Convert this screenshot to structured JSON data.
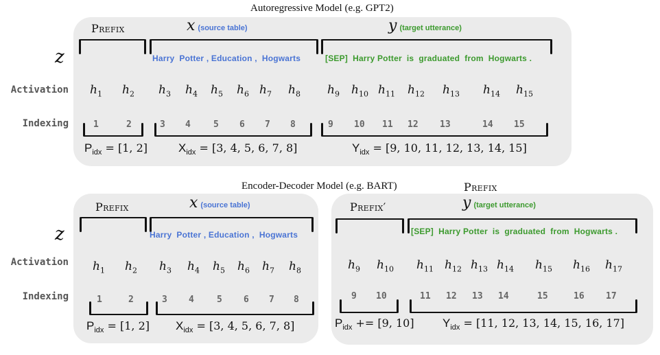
{
  "autoregressive": {
    "title": "Autoregressive Model  (e.g. GPT2)",
    "labels": {
      "prefix": "Prefix",
      "x": "x",
      "x_note": "(source table)",
      "y": "y",
      "y_note": "(target utterance)"
    },
    "source_tokens": "Harry  Potter , Education ,  Hogwarts",
    "target_tokens": "[SEP]  Harry Potter  is  graduated  from  Hogwarts .",
    "activations": [
      "1",
      "2",
      "3",
      "4",
      "5",
      "6",
      "7",
      "8",
      "9",
      "10",
      "11",
      "12",
      "13",
      "14",
      "15"
    ],
    "indices": [
      "1",
      "2",
      "3",
      "4",
      "5",
      "6",
      "7",
      "8",
      "9",
      "10",
      "11",
      "12",
      "13",
      "14",
      "15"
    ],
    "formulas": {
      "p_sym": "P",
      "p_sub": "idx",
      "p_rest": " = [1, 2]",
      "x_sym": "X",
      "x_sub": "idx",
      "x_rest": " = [3, 4, 5, 6, 7, 8]",
      "y_sym": "Y",
      "y_sub": "idx",
      "y_rest": " = [9, 10, 11, 12, 13, 14, 15]"
    }
  },
  "encoder_decoder": {
    "title": "Encoder-Decoder Model  (e.g. BART)",
    "extra_label": "Prefix",
    "encoder": {
      "labels": {
        "prefix": "Prefix",
        "x": "x",
        "x_note": "(source table)"
      },
      "source_tokens": "Harry  Potter , Education ,  Hogwarts",
      "activations": [
        "1",
        "2",
        "3",
        "4",
        "5",
        "6",
        "7",
        "8"
      ],
      "indices": [
        "1",
        "2",
        "3",
        "4",
        "5",
        "6",
        "7",
        "8"
      ],
      "formulas": {
        "p_sym": "P",
        "p_sub": "idx",
        "p_rest": " = [1, 2]",
        "x_sym": "X",
        "x_sub": "idx",
        "x_rest": " = [3, 4, 5, 6, 7, 8]"
      }
    },
    "decoder": {
      "labels": {
        "prefix": "Prefix′",
        "y": "y",
        "y_note": "(target utterance)"
      },
      "target_tokens": "[SEP]  Harry Potter  is  graduated  from  Hogwarts .",
      "activations": [
        "9",
        "10",
        "11",
        "12",
        "13",
        "14",
        "15",
        "16",
        "17"
      ],
      "indices": [
        "9",
        "10",
        "11",
        "12",
        "13",
        "14",
        "15",
        "16",
        "17"
      ],
      "formulas": {
        "p_sym": "P",
        "p_sub": "idx",
        "p_rest": " += [9, 10]",
        "y_sym": "Y",
        "y_sub": "idx",
        "y_rest": " = [11, 12, 13, 14, 15, 16, 17]"
      }
    }
  },
  "row_labels": {
    "z": "z",
    "activation": "Activation",
    "indexing": "Indexing"
  }
}
